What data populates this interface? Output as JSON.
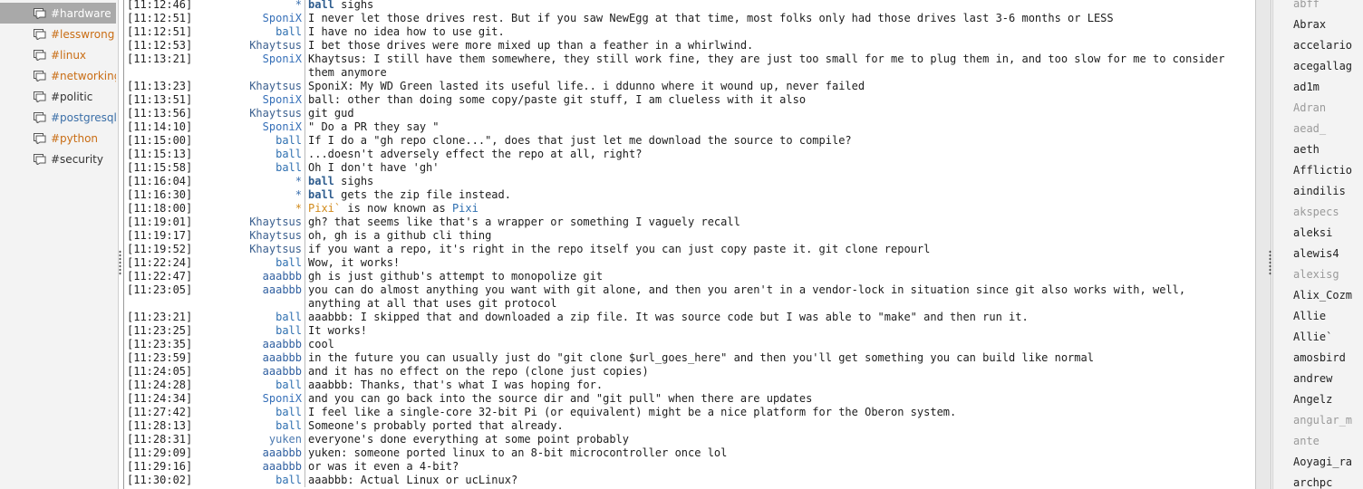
{
  "channels": [
    {
      "label": "#hardware",
      "state": "selected"
    },
    {
      "label": "#lesswrong",
      "state": "highlight"
    },
    {
      "label": "#linux",
      "state": "highlight"
    },
    {
      "label": "#networking",
      "state": "highlight"
    },
    {
      "label": "#politic",
      "state": "normal"
    },
    {
      "label": "#postgresql",
      "state": "active"
    },
    {
      "label": "#python",
      "state": "highlight"
    },
    {
      "label": "#security",
      "state": "normal"
    }
  ],
  "messages": [
    {
      "ts": "[11:12:46]",
      "nick": "*",
      "msg": "sighs",
      "action_nick": "ball"
    },
    {
      "ts": "[11:12:51]",
      "nick": "SponiX",
      "msg": "I never let those drives rest. But if you saw NewEgg at that time, most folks only had those drives last 3-6 months or LESS"
    },
    {
      "ts": "[11:12:51]",
      "nick": "ball",
      "msg": "I have no idea how to use git."
    },
    {
      "ts": "[11:12:53]",
      "nick": "Khaytsus",
      "msg": "I bet those drives were more  mixed up than a feather in a whirlwind."
    },
    {
      "ts": "[11:13:21]",
      "nick": "SponiX",
      "msg": "Khaytsus: I still have them somewhere, they still work fine, they are just too small for me to plug them in, and too slow for me to consider them anymore"
    },
    {
      "ts": "[11:13:23]",
      "nick": "Khaytsus",
      "msg": "SponiX: My WD Green lasted its useful life..  i ddunno where it wound up, never failed"
    },
    {
      "ts": "[11:13:51]",
      "nick": "SponiX",
      "msg": "ball: other than doing some copy/paste git stuff, I am clueless with it also"
    },
    {
      "ts": "[11:13:56]",
      "nick": "Khaytsus",
      "msg": "git gud"
    },
    {
      "ts": "[11:14:10]",
      "nick": "SponiX",
      "msg": "\" Do a PR they say \""
    },
    {
      "ts": "[11:15:00]",
      "nick": "ball",
      "msg": "If I do a \"gh repo clone...\", does that just let me download the source to compile?"
    },
    {
      "ts": "[11:15:13]",
      "nick": "ball",
      "msg": "...doesn't adversely effect the repo at all, right?"
    },
    {
      "ts": "[11:15:58]",
      "nick": "ball",
      "msg": "Oh I don't have 'gh'"
    },
    {
      "ts": "[11:16:04]",
      "nick": "*",
      "msg": "sighs",
      "action_nick": "ball"
    },
    {
      "ts": "[11:16:30]",
      "nick": "*",
      "msg": "gets the zip file instead.",
      "action_nick": "ball"
    },
    {
      "ts": "[11:18:00]",
      "nick": "*",
      "msg_a": "Pixi`",
      "msg_b": " is now known as ",
      "msg_c": "Pixi",
      "kind": "nickchange"
    },
    {
      "ts": "[11:19:01]",
      "nick": "Khaytsus",
      "msg": "gh?  that seems like that's a wrapper or something I vaguely recall"
    },
    {
      "ts": "[11:19:17]",
      "nick": "Khaytsus",
      "msg": "oh, gh is a github cli thing"
    },
    {
      "ts": "[11:19:52]",
      "nick": "Khaytsus",
      "msg": "if you want a repo, it's right in the repo itself you can just copy paste it.  git clone repourl"
    },
    {
      "ts": "[11:22:24]",
      "nick": "ball",
      "msg": "Wow, it works!"
    },
    {
      "ts": "[11:22:47]",
      "nick": "aaabbb",
      "msg": "gh is just github's attempt to monopolize git"
    },
    {
      "ts": "[11:23:05]",
      "nick": "aaabbb",
      "msg": "you can do almost anything you want with git alone, and then you aren't in a vendor-lock in situation since git also works with, well, anything at all that uses git protocol"
    },
    {
      "ts": "[11:23:21]",
      "nick": "ball",
      "msg": "aaabbb: I skipped that and downloaded a zip file.  It was source code but I was able to \"make\" and then run it."
    },
    {
      "ts": "[11:23:25]",
      "nick": "ball",
      "msg": "It works!"
    },
    {
      "ts": "[11:23:35]",
      "nick": "aaabbb",
      "msg": "cool"
    },
    {
      "ts": "[11:23:59]",
      "nick": "aaabbb",
      "msg": "in the future you can usually just do \"git clone $url_goes_here\" and then you'll get something you can build like normal"
    },
    {
      "ts": "[11:24:05]",
      "nick": "aaabbb",
      "msg": "and it has no effect on the repo (clone just copies)"
    },
    {
      "ts": "[11:24:28]",
      "nick": "ball",
      "msg": "aaabbb: Thanks, that's what I was hoping for."
    },
    {
      "ts": "[11:24:34]",
      "nick": "SponiX",
      "msg": "and you can go back into the source dir and \"git pull\" when there are updates"
    },
    {
      "ts": "[11:27:42]",
      "nick": "ball",
      "msg": "I feel like a single-core 32-bit Pi (or equivalent) might be a nice platform for the Oberon system."
    },
    {
      "ts": "[11:28:13]",
      "nick": "ball",
      "msg": "Someone's probably ported that already."
    },
    {
      "ts": "[11:28:31]",
      "nick": "yuken",
      "msg": "everyone's done everything at some point probably"
    },
    {
      "ts": "[11:29:09]",
      "nick": "aaabbb",
      "msg": "yuken: someone ported linux to an 8-bit microcontroller once lol"
    },
    {
      "ts": "[11:29:16]",
      "nick": "aaabbb",
      "msg": "or was it even a 4-bit?"
    },
    {
      "ts": "[11:30:02]",
      "nick": "ball",
      "msg": "aaabbb: Actual Linux or ucLinux?"
    }
  ],
  "users": [
    {
      "name": "abff",
      "away": true
    },
    {
      "name": "Abrax",
      "away": false
    },
    {
      "name": "accelario",
      "away": false
    },
    {
      "name": "acegallag",
      "away": false
    },
    {
      "name": "ad1m",
      "away": false
    },
    {
      "name": "Adran",
      "away": true
    },
    {
      "name": "aead_",
      "away": true
    },
    {
      "name": "aeth",
      "away": false
    },
    {
      "name": "Afflictio",
      "away": false
    },
    {
      "name": "aindilis",
      "away": false
    },
    {
      "name": "akspecs",
      "away": true
    },
    {
      "name": "aleksi",
      "away": false
    },
    {
      "name": "alewis4",
      "away": false
    },
    {
      "name": "alexisg",
      "away": true
    },
    {
      "name": "Alix_Cozm",
      "away": false
    },
    {
      "name": "Allie",
      "away": false
    },
    {
      "name": "Allie`",
      "away": false
    },
    {
      "name": "amosbird",
      "away": false
    },
    {
      "name": "andrew",
      "away": false
    },
    {
      "name": "Angelz",
      "away": false
    },
    {
      "name": "angular_m",
      "away": true
    },
    {
      "name": "ante",
      "away": true
    },
    {
      "name": "Aoyagi_ra",
      "away": false
    },
    {
      "name": "archpc",
      "away": false
    }
  ],
  "colors": {
    "selected_bg": "#a9a9a9",
    "highlight_channel": "#c96d14",
    "active_channel": "#3b6fa8",
    "nick_blue": "#2e6fb0",
    "join_orange": "#d18a1a"
  },
  "icons": {
    "channel": "chat-bubble-icon"
  }
}
